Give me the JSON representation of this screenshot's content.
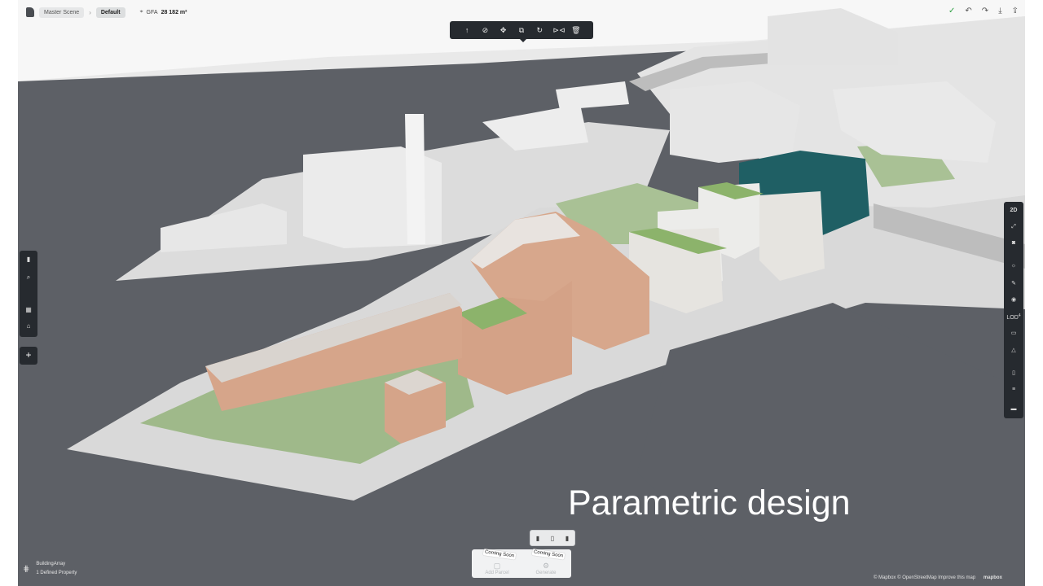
{
  "header": {
    "breadcrumb": [
      "Master Scene",
      "Default"
    ],
    "breadcrumb_separator": "›",
    "gfa_label": "GFA",
    "gfa_value": "28 182 m²",
    "gfa_icon": "tag-icon"
  },
  "top_right": {
    "icons": [
      "check-icon",
      "undo-icon",
      "redo-icon",
      "download-icon",
      "share-icon"
    ],
    "glyphs": [
      "✓",
      "↶",
      "↷",
      "⤓",
      "⇪"
    ]
  },
  "toolbar": {
    "icons": [
      "arrow-up-icon",
      "eye-off-icon",
      "move-icon",
      "copy-icon",
      "rotate-icon",
      "mirror-icon",
      "trash-icon"
    ],
    "glyphs": [
      "↑",
      "⊘",
      "✥",
      "⧉",
      "↻",
      "⊳⊲",
      "🗑"
    ]
  },
  "left_tools": {
    "icons": [
      "chart-icon",
      "search-icon",
      "layout-icon",
      "road-icon"
    ],
    "glyphs": [
      "▮",
      "⌕",
      "▦",
      "⌂"
    ],
    "add_label": "+"
  },
  "right_tools": {
    "view_2d_label": "2D",
    "lod_label": "LOD",
    "lod_sup": "4",
    "icons": [
      "expand-icon",
      "camera-icon",
      "sun-icon",
      "paint-icon",
      "eye-icon",
      "comment-icon",
      "terrain-icon",
      "phone-icon",
      "layers-icon",
      "minus-icon"
    ],
    "glyphs": [
      "⤢",
      "◙",
      "☼",
      "✎",
      "◉",
      "▭",
      "△",
      "▯",
      "≡",
      "▬"
    ]
  },
  "overlay": {
    "title": "Parametric design"
  },
  "bottom_panel": {
    "segment_icons": [
      "building-type-1-icon",
      "building-type-2-icon",
      "building-type-3-icon"
    ],
    "segment_glyphs": [
      "▮",
      "▯",
      "▮"
    ],
    "items": [
      {
        "label": "Add Parcel",
        "badge": "Coming Soon",
        "glyph": "▢"
      },
      {
        "label": "Generate",
        "badge": "Coming Soon",
        "glyph": "⚙"
      }
    ]
  },
  "bottom_left": {
    "icon_glyph": "⋕",
    "title": "BuildingArray",
    "subtitle": "1 Defined Property"
  },
  "attribution": {
    "text": "© Mapbox  © OpenStreetMap  Improve this map",
    "brand": "mapbox"
  }
}
